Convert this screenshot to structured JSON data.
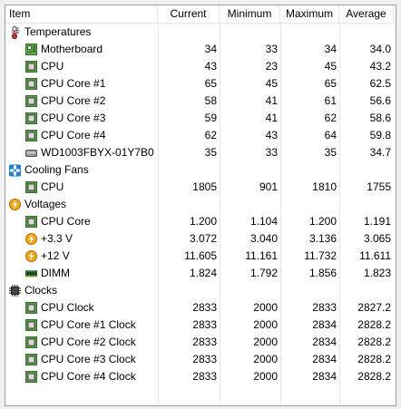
{
  "columns": {
    "item": "Item",
    "current": "Current",
    "minimum": "Minimum",
    "maximum": "Maximum",
    "average": "Average"
  },
  "rows": [
    {
      "type": "group",
      "label": "Temperatures",
      "icon": "thermometer-icon"
    },
    {
      "type": "item",
      "label": "Motherboard",
      "icon": "motherboard-icon",
      "cur": "34",
      "min": "33",
      "max": "34",
      "avg": "34.0"
    },
    {
      "type": "item",
      "label": "CPU",
      "icon": "chip-icon",
      "cur": "43",
      "min": "23",
      "max": "45",
      "avg": "43.2"
    },
    {
      "type": "item",
      "label": "CPU Core #1",
      "icon": "chip-icon",
      "cur": "65",
      "min": "45",
      "max": "65",
      "avg": "62.5"
    },
    {
      "type": "item",
      "label": "CPU Core #2",
      "icon": "chip-icon",
      "cur": "58",
      "min": "41",
      "max": "61",
      "avg": "56.6"
    },
    {
      "type": "item",
      "label": "CPU Core #3",
      "icon": "chip-icon",
      "cur": "59",
      "min": "41",
      "max": "62",
      "avg": "58.6"
    },
    {
      "type": "item",
      "label": "CPU Core #4",
      "icon": "chip-icon",
      "cur": "62",
      "min": "43",
      "max": "64",
      "avg": "59.8"
    },
    {
      "type": "item",
      "label": "WD1003FBYX-01Y7B0",
      "icon": "hard-drive-icon",
      "cur": "35",
      "min": "33",
      "max": "35",
      "avg": "34.7"
    },
    {
      "type": "group",
      "label": "Cooling Fans",
      "icon": "fan-icon"
    },
    {
      "type": "item",
      "label": "CPU",
      "icon": "chip-icon",
      "cur": "1805",
      "min": "901",
      "max": "1810",
      "avg": "1755"
    },
    {
      "type": "group",
      "label": "Voltages",
      "icon": "voltage-icon"
    },
    {
      "type": "item",
      "label": "CPU Core",
      "icon": "chip-icon",
      "cur": "1.200",
      "min": "1.104",
      "max": "1.200",
      "avg": "1.191"
    },
    {
      "type": "item",
      "label": "+3.3 V",
      "icon": "voltage-icon",
      "cur": "3.072",
      "min": "3.040",
      "max": "3.136",
      "avg": "3.065"
    },
    {
      "type": "item",
      "label": "+12 V",
      "icon": "voltage-icon",
      "cur": "11.605",
      "min": "11.161",
      "max": "11.732",
      "avg": "11.611"
    },
    {
      "type": "item",
      "label": "DIMM",
      "icon": "memory-icon",
      "cur": "1.824",
      "min": "1.792",
      "max": "1.856",
      "avg": "1.823"
    },
    {
      "type": "group",
      "label": "Clocks",
      "icon": "clock-icon"
    },
    {
      "type": "item",
      "label": "CPU Clock",
      "icon": "chip-icon",
      "cur": "2833",
      "min": "2000",
      "max": "2833",
      "avg": "2827.2"
    },
    {
      "type": "item",
      "label": "CPU Core #1 Clock",
      "icon": "chip-icon",
      "cur": "2833",
      "min": "2000",
      "max": "2834",
      "avg": "2828.2"
    },
    {
      "type": "item",
      "label": "CPU Core #2 Clock",
      "icon": "chip-icon",
      "cur": "2833",
      "min": "2000",
      "max": "2834",
      "avg": "2828.2"
    },
    {
      "type": "item",
      "label": "CPU Core #3 Clock",
      "icon": "chip-icon",
      "cur": "2833",
      "min": "2000",
      "max": "2834",
      "avg": "2828.2"
    },
    {
      "type": "item",
      "label": "CPU Core #4 Clock",
      "icon": "chip-icon",
      "cur": "2833",
      "min": "2000",
      "max": "2834",
      "avg": "2828.2"
    }
  ]
}
